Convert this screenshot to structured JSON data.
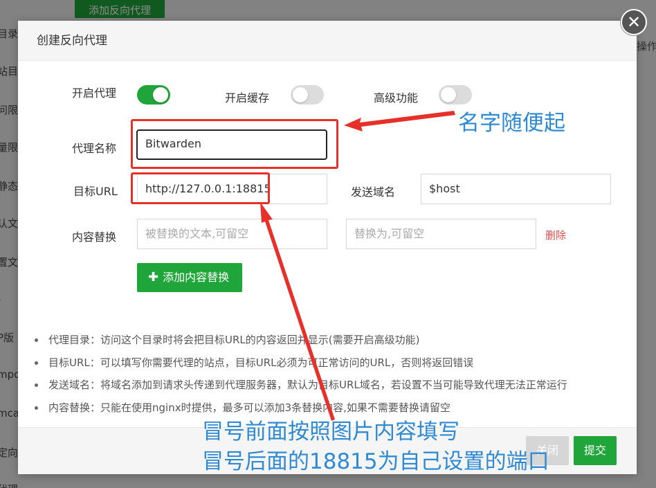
{
  "background": {
    "top_button": "添加反向代理",
    "side_items": [
      "目录",
      "站目",
      "问限",
      "量限",
      "静态",
      "认文",
      "置文",
      "-",
      "P版",
      "mpo",
      "mca",
      "定向",
      "代理"
    ],
    "column_op": "操作"
  },
  "dialog": {
    "title": "创建反向代理",
    "toggles": {
      "enable_proxy": {
        "label": "开启代理",
        "on": true
      },
      "enable_cache": {
        "label": "开启缓存",
        "on": false
      },
      "advanced": {
        "label": "高级功能",
        "on": false
      }
    },
    "proxy_name": {
      "label": "代理名称",
      "value": "Bitwarden"
    },
    "target_url": {
      "label": "目标URL",
      "value": "http://127.0.0.1:18815"
    },
    "send_domain": {
      "label": "发送域名",
      "value": "$host"
    },
    "content_replace": {
      "label": "内容替换",
      "replaced_placeholder": "被替换的文本,可留空",
      "replacement_placeholder": "替换为,可留空",
      "delete_label": "删除"
    },
    "add_replace_button": "添加内容替换",
    "tips": [
      "代理目录：访问这个目录时将会把目标URL的内容返回并显示(需要开启高级功能)",
      "目标URL：可以填写你需要代理的站点，目标URL必须为可正常访问的URL，否则将返回错误",
      "发送域名：将域名添加到请求头传递到代理服务器，默认为目标URL域名，若设置不当可能导致代理无法正常运行",
      "内容替换：只能在使用nginx时提供，最多可以添加3条替换内容,如果不需要替换请留空"
    ],
    "footer": {
      "close_label": "关闭",
      "submit_label": "提交"
    }
  },
  "annotations": {
    "name_note": "名字随便起",
    "url_note_line1": "冒号前面按照图片内容填写",
    "url_note_line2": "冒号后面的18815为自己设置的端口",
    "color_red": "#e8302a",
    "color_blue": "#2f8ad4"
  },
  "icons": {
    "close": "close-icon",
    "plus": "plus-icon"
  },
  "colors": {
    "accent": "#20a53a",
    "danger": "#e04b4b"
  }
}
